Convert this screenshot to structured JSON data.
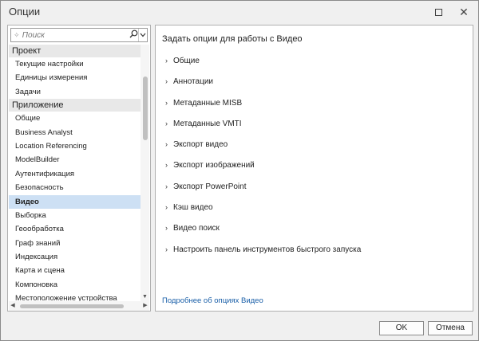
{
  "window": {
    "title": "Опции",
    "close_glyph": "✕"
  },
  "search": {
    "placeholder": "Поиск"
  },
  "sidebar": {
    "groups": [
      {
        "label": "Проект",
        "items": [
          "Текущие настройки",
          "Единицы измерения",
          "Задачи"
        ]
      },
      {
        "label": "Приложение",
        "items": [
          "Общие",
          "Business Analyst",
          "Location Referencing",
          "ModelBuilder",
          "Аутентификация",
          "Безопасность",
          "Видео",
          "Выборка",
          "Геообработка",
          "Граф знаний",
          "Индексация",
          "Карта и сцена",
          "Компоновка",
          "Местоположение устройства"
        ]
      }
    ],
    "selected": "Видео"
  },
  "main": {
    "heading": "Задать опции для работы с Видео",
    "sections": [
      "Общие",
      "Аннотации",
      "Метаданные MISB",
      "Метаданные VMTI",
      "Экспорт видео",
      "Экспорт изображений",
      "Экспорт PowerPoint",
      "Кэш видео",
      "Видео поиск",
      "Настроить панель инструментов быстрого запуска"
    ],
    "more_link": "Подробнее об опциях Видео"
  },
  "buttons": {
    "ok": "OK",
    "cancel": "Отмена"
  }
}
